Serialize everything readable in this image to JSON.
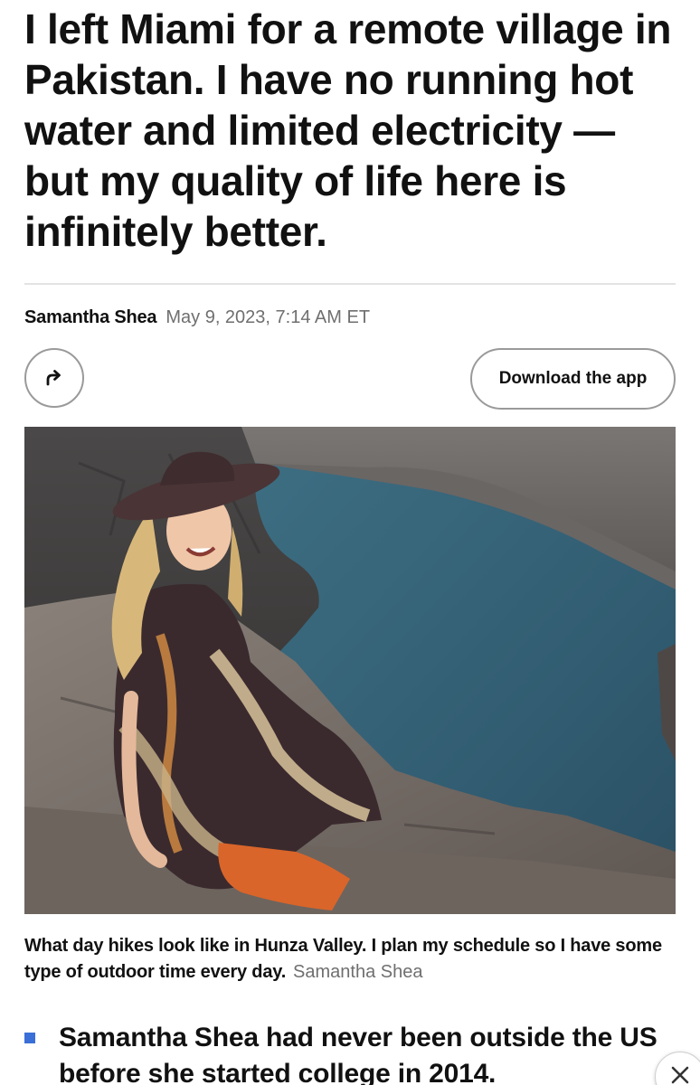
{
  "article": {
    "headline": "I left Miami for a remote village in Pakistan. I have no running hot water and limited electricity — but my quality of life here is infinitely better.",
    "author": "Samantha Shea",
    "date": "May 9, 2023, 7:14 AM ET"
  },
  "actions": {
    "share_icon": "share-arrow-icon",
    "download_app_label": "Download the app"
  },
  "photo": {
    "caption": "What day hikes look like in Hunza Valley. I plan my schedule so I have some type of outdoor time every day.",
    "credit": "Samantha Shea"
  },
  "key_points": [
    {
      "text": "Samantha Shea had never been outside the US before she started college in 2014."
    }
  ],
  "overlay": {
    "close_icon": "close-icon"
  },
  "colors": {
    "text": "#111111",
    "muted": "#6f6f6f",
    "border": "#9a9a9a",
    "bullet": "#3a6fd8",
    "divider": "#e3e3e3"
  }
}
